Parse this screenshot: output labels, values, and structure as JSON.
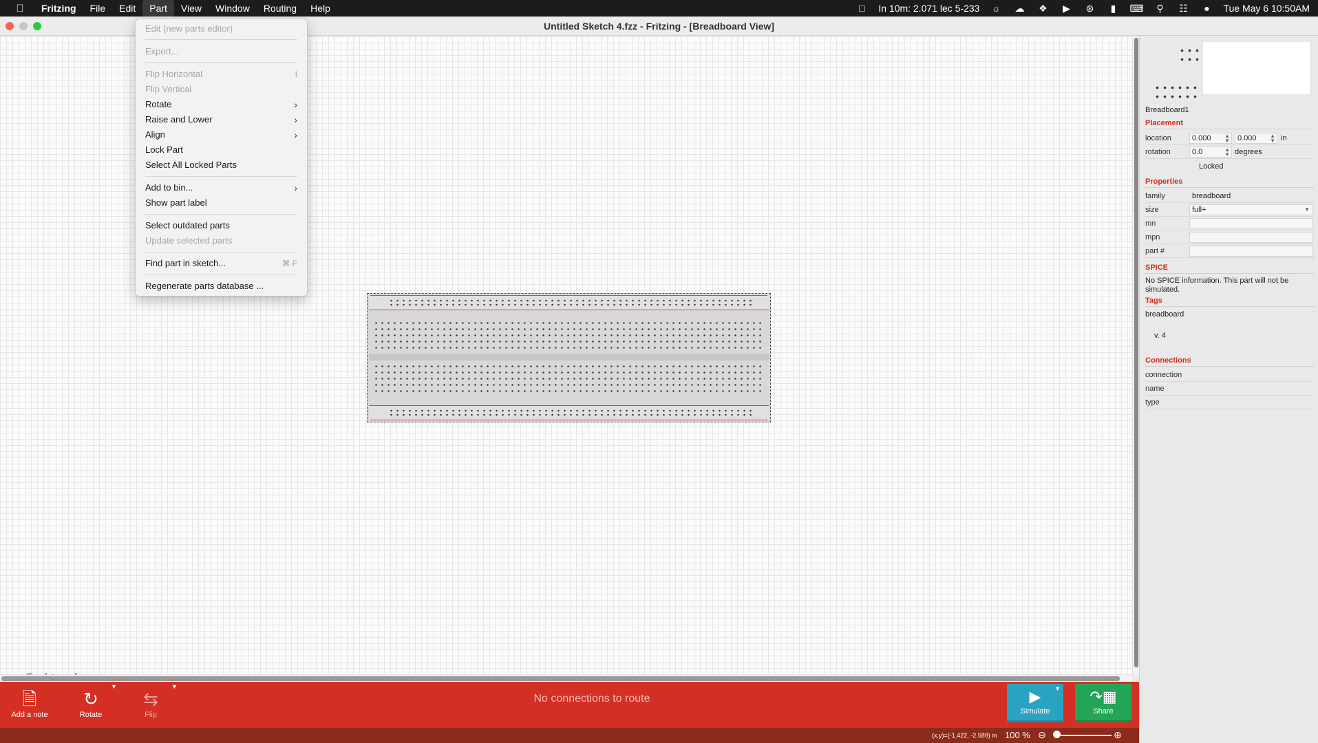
{
  "menubar": {
    "app_name": "Fritzing",
    "items": [
      "File",
      "Edit",
      "Part",
      "View",
      "Window",
      "Routing",
      "Help"
    ],
    "status_event": "In 10m: 2.071 lec 5-233",
    "datetime": "Tue May 6  10:50AM"
  },
  "window": {
    "title": "Untitled Sketch 4.fzz - Fritzing - [Breadboard View]"
  },
  "part_menu": {
    "items": [
      {
        "label": "Edit (new parts editor)",
        "enabled": false
      },
      {
        "label": "Export...",
        "enabled": false
      },
      {
        "label": "Flip Horizontal",
        "enabled": false,
        "shortcut": "I"
      },
      {
        "label": "Flip Vertical",
        "enabled": false
      },
      {
        "label": "Rotate",
        "enabled": true,
        "submenu": true
      },
      {
        "label": "Raise and Lower",
        "enabled": true,
        "submenu": true
      },
      {
        "label": "Align",
        "enabled": true,
        "submenu": true
      },
      {
        "label": "Lock Part",
        "enabled": true
      },
      {
        "label": "Select All Locked Parts",
        "enabled": true
      },
      {
        "label": "Add to bin...",
        "enabled": true,
        "submenu": true
      },
      {
        "label": "Show part label",
        "enabled": true
      },
      {
        "label": "Select outdated parts",
        "enabled": true
      },
      {
        "label": "Update selected parts",
        "enabled": false
      },
      {
        "label": "Find part in sketch...",
        "enabled": true,
        "shortcut": "⌘ F"
      },
      {
        "label": "Regenerate parts database ...",
        "enabled": true
      }
    ]
  },
  "canvas": {
    "watermark": "fritzing"
  },
  "inspector": {
    "part_title": "Breadboard1",
    "placement": {
      "heading": "Placement",
      "location_label": "location",
      "location_x": "0.000",
      "location_y": "0.000",
      "location_unit": "in",
      "rotation_label": "rotation",
      "rotation_value": "0.0",
      "rotation_unit": "degrees",
      "locked_label": "Locked"
    },
    "properties": {
      "heading": "Properties",
      "family_label": "family",
      "family_value": "breadboard",
      "size_label": "size",
      "size_value": "full+",
      "mn_label": "mn",
      "mpn_label": "mpn",
      "partnum_label": "part #"
    },
    "spice": {
      "heading": "SPICE",
      "text": "No SPICE information. This part will not be simulated."
    },
    "tags": {
      "heading": "Tags",
      "value": "breadboard",
      "version": "v. 4"
    },
    "connections": {
      "heading": "Connections",
      "connection_label": "connection",
      "name_label": "name",
      "type_label": "type"
    }
  },
  "toolbar": {
    "add_note": "Add a note",
    "rotate": "Rotate",
    "flip": "Flip",
    "route_status": "No connections to route",
    "simulate": "Simulate",
    "share": "Share"
  },
  "statusbar": {
    "coords": "(x,y)=(-1.422, -2.589) in",
    "zoom": "100 %"
  },
  "colors": {
    "toolbar_red": "#d42f24",
    "simulate_blue": "#2aa3c2",
    "share_green": "#24a456",
    "section_red": "#d52a1d"
  }
}
